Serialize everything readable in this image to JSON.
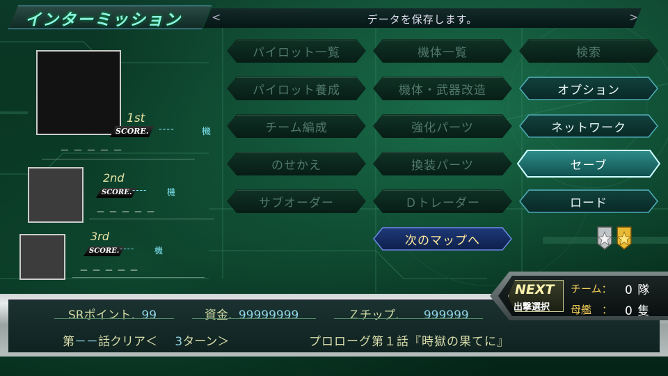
{
  "header": {
    "title": "インターミッション",
    "message": "データを保存します。",
    "arrow_left": "<",
    "arrow_right": ">"
  },
  "ranking": [
    {
      "place": "1st",
      "score_label": "SCORE.",
      "score": "----",
      "unit": "機",
      "name": "－－－－－"
    },
    {
      "place": "2nd",
      "score_label": "SCORE.",
      "score": "----",
      "unit": "機",
      "name": "－－－－－"
    },
    {
      "place": "3rd",
      "score_label": "SCORE.",
      "score": "----",
      "unit": "機",
      "name": "－－－－－"
    }
  ],
  "menu": {
    "pilot_list": "パイロット一覧",
    "unit_list": "機体一覧",
    "search": "検索",
    "pilot_training": "パイロット養成",
    "unit_upgrade": "機体・武器改造",
    "options": "オプション",
    "team_formation": "チーム編成",
    "enhance_parts": "強化パーツ",
    "network": "ネットワーク",
    "change_outfit": "のせかえ",
    "equip_parts": "換装パーツ",
    "save": "セーブ",
    "sub_order": "サブオーダー",
    "d_trader": "Ｄトレーダー",
    "load": "ロード",
    "next_map": "次のマップへ"
  },
  "medals": [
    "silver-medal-icon",
    "gold-medal-icon"
  ],
  "next_sortie": {
    "label": "NEXT",
    "sub": "出撃選択",
    "team_label": "チーム：",
    "team_value": "0",
    "team_unit": "隊",
    "ship_label": "母艦　：",
    "ship_value": "0",
    "ship_unit": "隻"
  },
  "stats": {
    "sr_label": "SRポイント.",
    "sr_value": "99",
    "funds_label": "資金.",
    "funds_value": "99999999",
    "z_label": "Ｚチップ.",
    "z_value": "999999"
  },
  "progress": {
    "chapter_prefix": "第",
    "chapter_num": "－－",
    "chapter_suffix": "話クリア＜",
    "turns_value": "3",
    "turns_suffix": "ターン＞",
    "story_title": "プロローグ第１話『時獄の果てに』"
  }
}
